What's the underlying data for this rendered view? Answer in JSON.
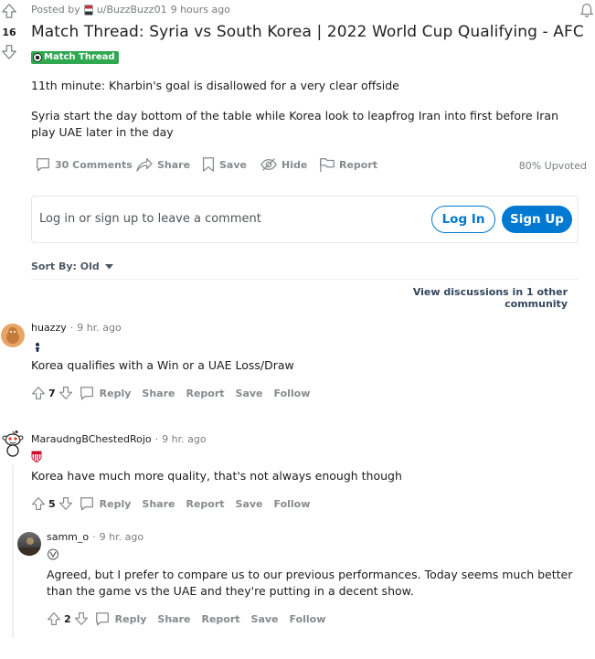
{
  "post": {
    "score": "16",
    "posted_by_prefix": "Posted by",
    "author": "u/BuzzBuzz01",
    "time": "9 hours ago",
    "title": "Match Thread: Syria vs South Korea | 2022 World Cup Qualifying - AFC",
    "flair": "Match Thread",
    "paragraphs": [
      "11th minute: Kharbin's goal is disallowed for a very clear offside",
      "Syria start the day bottom of the table while Korea look to leapfrog Iran into first before Iran play UAE later in the day"
    ],
    "actions": {
      "comments": "30 Comments",
      "share": "Share",
      "save": "Save",
      "hide": "Hide",
      "report": "Report"
    },
    "upvoted": "80% Upvoted"
  },
  "comment_prompt": {
    "text": "Log in or sign up to leave a comment",
    "login": "Log In",
    "signup": "Sign Up"
  },
  "sort": {
    "label": "Sort By: Old"
  },
  "other_discussions": "View discussions in 1 other community",
  "comment_actions": {
    "reply": "Reply",
    "share": "Share",
    "report": "Report",
    "save": "Save",
    "follow": "Follow"
  },
  "comments": [
    {
      "user": "huazzy",
      "time": "9 hr. ago",
      "text": "Korea qualifies with a Win or a UAE Loss/Draw",
      "score": "7"
    },
    {
      "user": "MaraudngBChestedRojo",
      "time": "9 hr. ago",
      "text": "Korea have much more quality, that's not always enough though",
      "score": "5"
    },
    {
      "user": "samm_o",
      "time": "9 hr. ago",
      "text": "Agreed, but I prefer to compare us to our previous performances. Today seems much better than the game vs the UAE and they're putting in a decent show.",
      "score": "2"
    }
  ],
  "separator": "·",
  "colors": {
    "accent": "#0079d3",
    "flair": "#2fa84f",
    "muted": "#878a8c"
  }
}
